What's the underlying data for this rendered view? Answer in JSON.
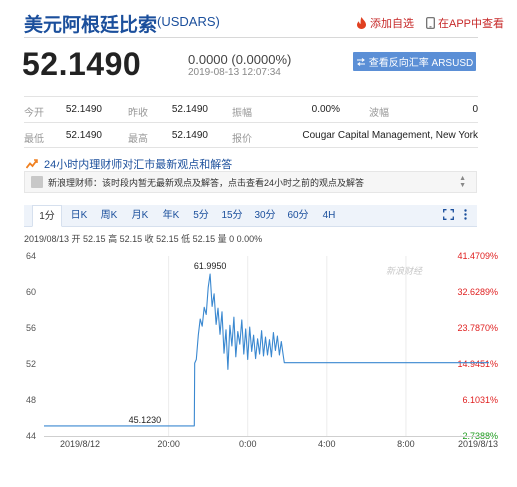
{
  "header": {
    "title": "美元阿根廷比索",
    "symbol": "(USDARS)",
    "add_watchlist": "添加自选",
    "view_in_app": "在APP中查看"
  },
  "quote": {
    "price": "52.1490",
    "change": "0.0000 (0.0000%)",
    "timestamp": "2019-08-13 12:07:34",
    "reverse_label": "查看反向汇率 ARSUSD"
  },
  "stats": {
    "row1": [
      {
        "label": "今开",
        "value": "52.1490"
      },
      {
        "label": "昨收",
        "value": "52.1490"
      },
      {
        "label": "振幅",
        "value": "0.00%"
      },
      {
        "label": "波幅",
        "value": "0"
      }
    ],
    "row2": [
      {
        "label": "最低",
        "value": "52.1490"
      },
      {
        "label": "最高",
        "value": "52.1490"
      },
      {
        "label": "报价",
        "value": "Cougar Capital Management, New York"
      }
    ]
  },
  "news": {
    "title": "24小时内理财师对汇市最新观点和解答",
    "item": "新浪理财师：该时段内暂无最新观点及解答，点击查看24小时之前的观点及解答"
  },
  "tabs": [
    "1分",
    "日K",
    "周K",
    "月K",
    "年K",
    "5分",
    "15分",
    "30分",
    "60分",
    "4H"
  ],
  "chart_info": "2019/08/13 开 52.15 高 52.15 收 52.15 低 52.15 量 0 0.00%",
  "watermark": "新浪财经",
  "colors": {
    "brand": "#1b4f9c",
    "line": "#3a88d0",
    "axis_up": "#e02020",
    "axis_down": "#1a9a1a",
    "button": "#5b8fd6"
  },
  "chart_data": {
    "type": "line",
    "y_ticks": [
      64,
      60,
      56,
      52,
      48,
      44
    ],
    "ylim": [
      44,
      64
    ],
    "right_ticks": [
      "41.4709%",
      "32.6289%",
      "23.7870%",
      "14.9451%",
      "6.1031%",
      "-2.7388%"
    ],
    "x_tick_labels": [
      "2019/8/12",
      "20:00",
      "0:00",
      "4:00",
      "8:00",
      "2019/8/13"
    ],
    "x_tick_hours": [
      -6.3,
      0,
      4,
      8,
      12,
      16.2
    ],
    "annotations": [
      {
        "label": "61.9950",
        "x_hour": 2.1,
        "y": 61.995
      },
      {
        "label": "45.1230",
        "x_hour": -1.2,
        "y": 45.123
      }
    ],
    "series": [
      {
        "x": [
          -6.3,
          0.5,
          1.3,
          1.32,
          1.4,
          1.5,
          1.6,
          1.7,
          1.8,
          1.9,
          2.0,
          2.1,
          2.2,
          2.3,
          2.4,
          2.5,
          2.6,
          2.7,
          2.8,
          2.9,
          3.0,
          3.1,
          3.2,
          3.3,
          3.4,
          3.5,
          3.6,
          3.7,
          3.8,
          3.9,
          4.0,
          4.1,
          4.2,
          4.3,
          4.4,
          4.5,
          4.6,
          4.7,
          4.8,
          4.9,
          5.0,
          5.1,
          5.2,
          5.3,
          5.4,
          5.5,
          5.6,
          5.7,
          5.8,
          5.85,
          16.2
        ],
        "y": [
          45.12,
          45.12,
          45.12,
          52.1,
          52.5,
          55.2,
          57.0,
          56.2,
          58.3,
          57.5,
          60.5,
          61.99,
          58.4,
          59.8,
          56.4,
          58.2,
          55.3,
          57.8,
          53.2,
          55.8,
          51.4,
          56.3,
          54.0,
          57.2,
          52.8,
          55.6,
          54.2,
          56.9,
          53.1,
          55.9,
          52.5,
          56.1,
          53.4,
          55.2,
          52.6,
          54.8,
          53.1,
          55.7,
          52.9,
          55.0,
          53.0,
          54.7,
          52.8,
          55.5,
          53.5,
          55.1,
          53.0,
          54.5,
          52.9,
          52.15,
          52.15
        ]
      }
    ]
  }
}
